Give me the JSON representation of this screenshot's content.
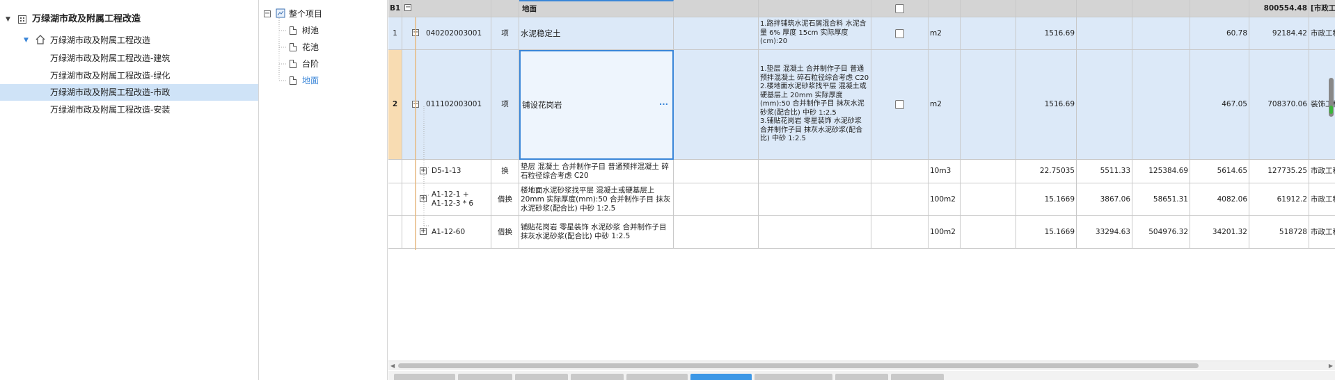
{
  "tree": {
    "root_label": "万绿湖市政及附属工程改造",
    "child_label": "万绿湖市政及附属工程改造",
    "units": [
      "万绿湖市政及附属工程改造-建筑",
      "万绿湖市政及附属工程改造-绿化",
      "万绿湖市政及附属工程改造-市政",
      "万绿湖市政及附属工程改造-安装"
    ]
  },
  "middle": {
    "root_label": "整个项目",
    "items": [
      "树池",
      "花池",
      "台阶",
      "地面"
    ]
  },
  "grid": {
    "header": {
      "code": "B1",
      "name": "地面",
      "total": "800554.48",
      "spec": "[市政工"
    },
    "rows": [
      {
        "idx": "1",
        "code": "040202003001",
        "type": "项",
        "name": "水泥稳定土",
        "features": "1.路拌铺筑水泥石屑混合料 水泥含量 6% 厚度 15cm  实际厚度(cm):20",
        "unit": "m2",
        "qty": "1516.69",
        "price": "",
        "amount": "",
        "comp_price": "60.78",
        "comp_amount": "92184.42",
        "spec": "市政工程"
      },
      {
        "idx": "2",
        "code": "011102003001",
        "type": "项",
        "name": "铺设花岗岩",
        "edit": "···",
        "features": "1.垫层 混凝土  合并制作子目 普通预拌混凝土 碎石粒径综合考虑 C20\n2.楼地面水泥砂浆找平层 混凝土或硬基层上 20mm  实际厚度(mm):50  合并制作子目 抹灰水泥砂浆(配合比) 中砂 1:2.5\n3.铺贴花岗岩 零星装饰 水泥砂浆  合并制作子目 抹灰水泥砂浆(配合比) 中砂 1:2.5",
        "unit": "m2",
        "qty": "1516.69",
        "price": "",
        "amount": "",
        "comp_price": "467.05",
        "comp_amount": "708370.06",
        "spec": "装饰工程"
      },
      {
        "idx": "",
        "code": "D5-1-13",
        "type": "换",
        "name": "垫层 混凝土  合并制作子目 普通预拌混凝土 碎石粒径综合考虑 C20",
        "features": "",
        "unit": "10m3",
        "qty": "22.75035",
        "price": "5511.33",
        "amount": "125384.69",
        "comp_price": "5614.65",
        "comp_amount": "127735.25",
        "spec": "市政工程"
      },
      {
        "idx": "",
        "code": "A1-12-1 +\nA1-12-3 * 6",
        "type": "借换",
        "name": "楼地面水泥砂浆找平层 混凝土或硬基层上 20mm  实际厚度(mm):50  合并制作子目 抹灰水泥砂浆(配合比) 中砂 1:2.5",
        "features": "",
        "unit": "100m2",
        "qty": "15.1669",
        "price": "3867.06",
        "amount": "58651.31",
        "comp_price": "4082.06",
        "comp_amount": "61912.2",
        "spec": "市政工程"
      },
      {
        "idx": "",
        "code": "A1-12-60",
        "type": "借换",
        "name": "铺贴花岗岩 零星装饰 水泥砂浆  合并制作子目 抹灰水泥砂浆(配合比) 中砂 1:2.5",
        "features": "",
        "unit": "100m2",
        "qty": "15.1669",
        "price": "33294.63",
        "amount": "504976.32",
        "comp_price": "34201.32",
        "comp_amount": "518728",
        "spec": "市政工程"
      }
    ]
  },
  "colors": {
    "selected_row": "#cfe3f7",
    "level1_row": "#dce9f8",
    "focus_border": "#3a86d8",
    "header_bg": "#d4d4d4",
    "active_tab": "#3c97e6"
  }
}
